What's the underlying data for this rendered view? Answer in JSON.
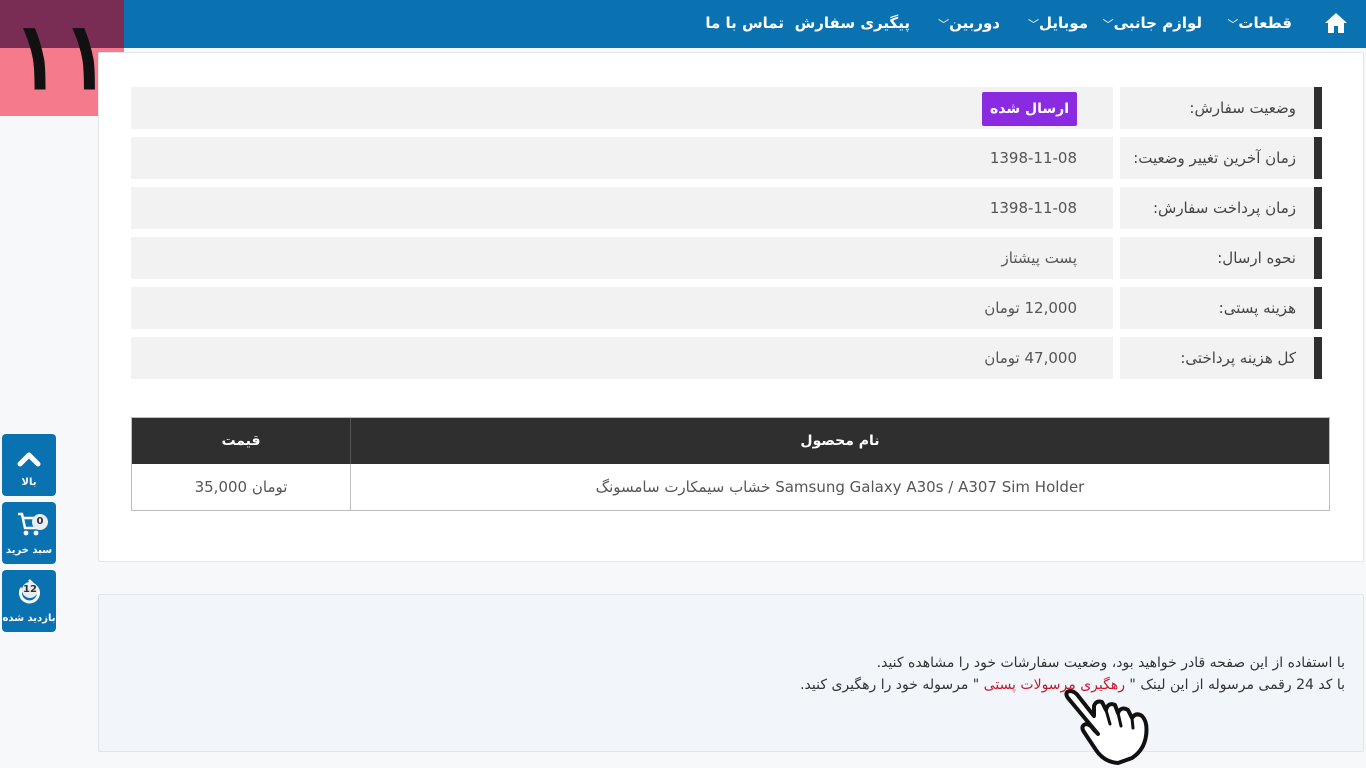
{
  "nav": {
    "home_icon": "home-icon",
    "items": [
      {
        "label": "قطعات",
        "dropdown": true
      },
      {
        "label": "لوازم جانبی",
        "dropdown": true
      },
      {
        "label": "موبایل",
        "dropdown": true
      },
      {
        "label": "دوربین",
        "dropdown": true
      },
      {
        "label": "پیگیری سفارش",
        "dropdown": false
      },
      {
        "label": "تماس با ما",
        "dropdown": false
      }
    ]
  },
  "corner_badge": {
    "text": "۱۱",
    "colors": {
      "top": "#7a2d54",
      "bottom": "#f47a8c"
    }
  },
  "side": {
    "top": {
      "label": "بالا",
      "icon": "chevron-up-icon"
    },
    "cart": {
      "label": "سبد خرید",
      "icon": "cart-icon",
      "count": "0"
    },
    "visited": {
      "label": "بازدید شده",
      "icon": "history-icon",
      "count": "12"
    }
  },
  "order": {
    "rows": [
      {
        "label": "وضعیت سفارش:",
        "value": "ارسال شده",
        "type": "badge"
      },
      {
        "label": "زمان آخرین تغییر وضعیت:",
        "value": "1398-11-08"
      },
      {
        "label": "زمان پرداخت سفارش:",
        "value": "1398-11-08"
      },
      {
        "label": "نحوه ارسال:",
        "value": "پست پیشتاز"
      },
      {
        "label": "هزینه پستی:",
        "value": "12,000 تومان"
      },
      {
        "label": "کل هزینه پرداختی:",
        "value": "47,000 تومان"
      }
    ],
    "status_color": "#8a2be2"
  },
  "products": {
    "headers": {
      "name": "نام محصول",
      "price": "قیمت"
    },
    "items": [
      {
        "name": "خشاب سیمکارت سامسونگ Samsung Galaxy A30s / A307 Sim Holder",
        "price": "35,000 تومان"
      }
    ]
  },
  "help": {
    "line1": "با استفاده از این صفحه قادر خواهید بود، وضعیت سفارشات خود را مشاهده کنید.",
    "line2_before": "با کد 24 رقمی مرسوله از این لینک \" ",
    "line2_link": "رهگیری مرسولات پستی",
    "line2_after": " \" مرسوله خود را رهگیری کنید."
  }
}
